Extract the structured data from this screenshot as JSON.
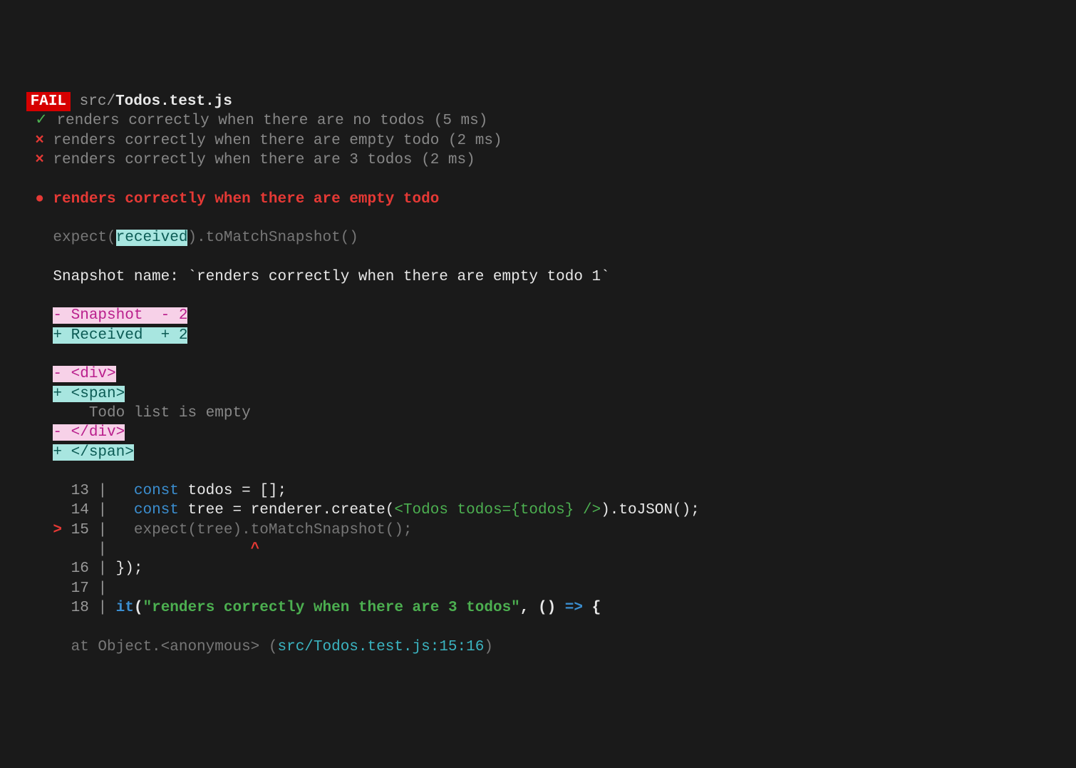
{
  "badge": "FAIL",
  "path_prefix": "src/",
  "path_file": "Todos.test.js",
  "tests": [
    {
      "mark": "✓",
      "label": "renders correctly when there are no todos (5 ms)"
    },
    {
      "mark": "×",
      "label": "renders correctly when there are empty todo (2 ms)"
    },
    {
      "mark": "×",
      "label": "renders correctly when there are 3 todos (2 ms)"
    }
  ],
  "fail_bullet": "●",
  "fail_title": "renders correctly when there are empty todo",
  "expect_prefix": "expect(",
  "expect_received": "received",
  "expect_call": ").toMatchSnapshot()",
  "snapshot_name_label": "Snapshot name: ",
  "snapshot_name_value": "`renders correctly when there are empty todo 1`",
  "diff_header_minus": "- Snapshot  - 2",
  "diff_header_plus": "+ Received  + 2",
  "diff": [
    {
      "type": "minus",
      "text": "- <div>"
    },
    {
      "type": "plus",
      "text": "+ <span>"
    },
    {
      "type": "ctx",
      "text": "    Todo list is empty"
    },
    {
      "type": "minus",
      "text": "- </div>"
    },
    {
      "type": "plus",
      "text": "+ </span>"
    }
  ],
  "code": {
    "l13_no": "13",
    "l14_no": "14",
    "l15_no": "15",
    "l16_no": "16",
    "l17_no": "17",
    "l18_no": "18",
    "kw_const": "const",
    "l13a": " todos = [];",
    "l14a": " tree = renderer.create(",
    "l14b": "<Todos todos={todos} />",
    "l14c": ").toJSON();",
    "l15a": "expect(tree).toMatchSnapshot();",
    "l16a": "});",
    "kw_it": "it",
    "l18a": "(",
    "l18str": "\"renders correctly when there are 3 todos\"",
    "l18b": ", () ",
    "kw_arrow": "=>",
    "l18c": " {",
    "pointer": ">",
    "caret": "^"
  },
  "stack_prefix": "at Object.<anonymous> (",
  "stack_link": "src/Todos.test.js:15:16",
  "stack_suffix": ")"
}
